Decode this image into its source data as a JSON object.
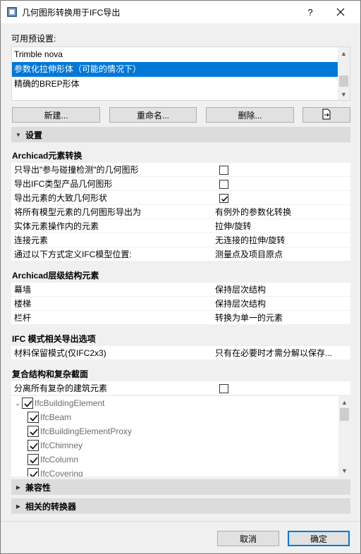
{
  "window": {
    "title": "几何图形转换用于IFC导出",
    "help": "?",
    "close": "✕"
  },
  "presets": {
    "label": "可用预设置:",
    "items": [
      {
        "label": "Trimble nova",
        "selected": false
      },
      {
        "label": "参数化拉伸形体（可能的情况下）",
        "selected": true
      },
      {
        "label": "精确的BREP形体",
        "selected": false
      }
    ]
  },
  "buttons": {
    "new": "新建...",
    "rename": "重命名...",
    "delete": "删除..."
  },
  "settings_section": {
    "title": "设置"
  },
  "element_conversion": {
    "title": "Archicad元素转换",
    "rows": [
      {
        "name": "只导出\"参与碰撞检测\"的几何图形",
        "value": "",
        "checkbox": true,
        "checked": false
      },
      {
        "name": "导出IFC类型产品几何图形",
        "value": "",
        "checkbox": true,
        "checked": false
      },
      {
        "name": "导出元素的大致几何形状",
        "value": "",
        "checkbox": true,
        "checked": true
      },
      {
        "name": "将所有模型元素的几何图形导出为",
        "value": "有例外的参数化转换",
        "checkbox": false
      },
      {
        "name": "实体元素操作内的元素",
        "value": "拉伸/旋转",
        "checkbox": false
      },
      {
        "name": "连接元素",
        "value": "无连接的拉伸/旋转",
        "checkbox": false
      },
      {
        "name": "通过以下方式定义IFC模型位置:",
        "value": "测量点及项目原点",
        "checkbox": false
      }
    ]
  },
  "hierarchy": {
    "title": "Archicad层级结构元素",
    "rows": [
      {
        "name": "幕墙",
        "value": "保持层次结构"
      },
      {
        "name": "楼梯",
        "value": "保持层次结构"
      },
      {
        "name": "栏杆",
        "value": "转换为单一的元素"
      }
    ]
  },
  "ifc_schema": {
    "title": "IFC 模式相关导出选项",
    "rows": [
      {
        "name": "材料保留模式(仅IFC2x3)",
        "value": "只有在必要时才需分解以保存..."
      }
    ]
  },
  "composite": {
    "title": "复合结构和复杂截面",
    "rows": [
      {
        "name": "分离所有复杂的建筑元素",
        "checked": false
      }
    ],
    "tree": [
      {
        "label": "IfcBuildingElement",
        "level": 0,
        "checked": true
      },
      {
        "label": "IfcBeam",
        "level": 1,
        "checked": true
      },
      {
        "label": "IfcBuildingElementProxy",
        "level": 1,
        "checked": true
      },
      {
        "label": "IfcChimney",
        "level": 1,
        "checked": true
      },
      {
        "label": "IfcColumn",
        "level": 1,
        "checked": true
      },
      {
        "label": "IfcCovering",
        "level": 1,
        "checked": true
      }
    ]
  },
  "collapsed_sections": [
    {
      "title": "兼容性"
    },
    {
      "title": "相关的转换器"
    }
  ],
  "footer": {
    "cancel": "取消",
    "ok": "确定"
  },
  "colors": {
    "selection": "#0078d7",
    "header_bg": "#dcdcdc",
    "ok_border": "#0078d7"
  },
  "icons": [
    "app-icon",
    "help-icon",
    "close-icon",
    "export-icon",
    "collapse-triangle-icon",
    "expand-triangle-icon",
    "check-icon",
    "tree-expander-icon"
  ]
}
